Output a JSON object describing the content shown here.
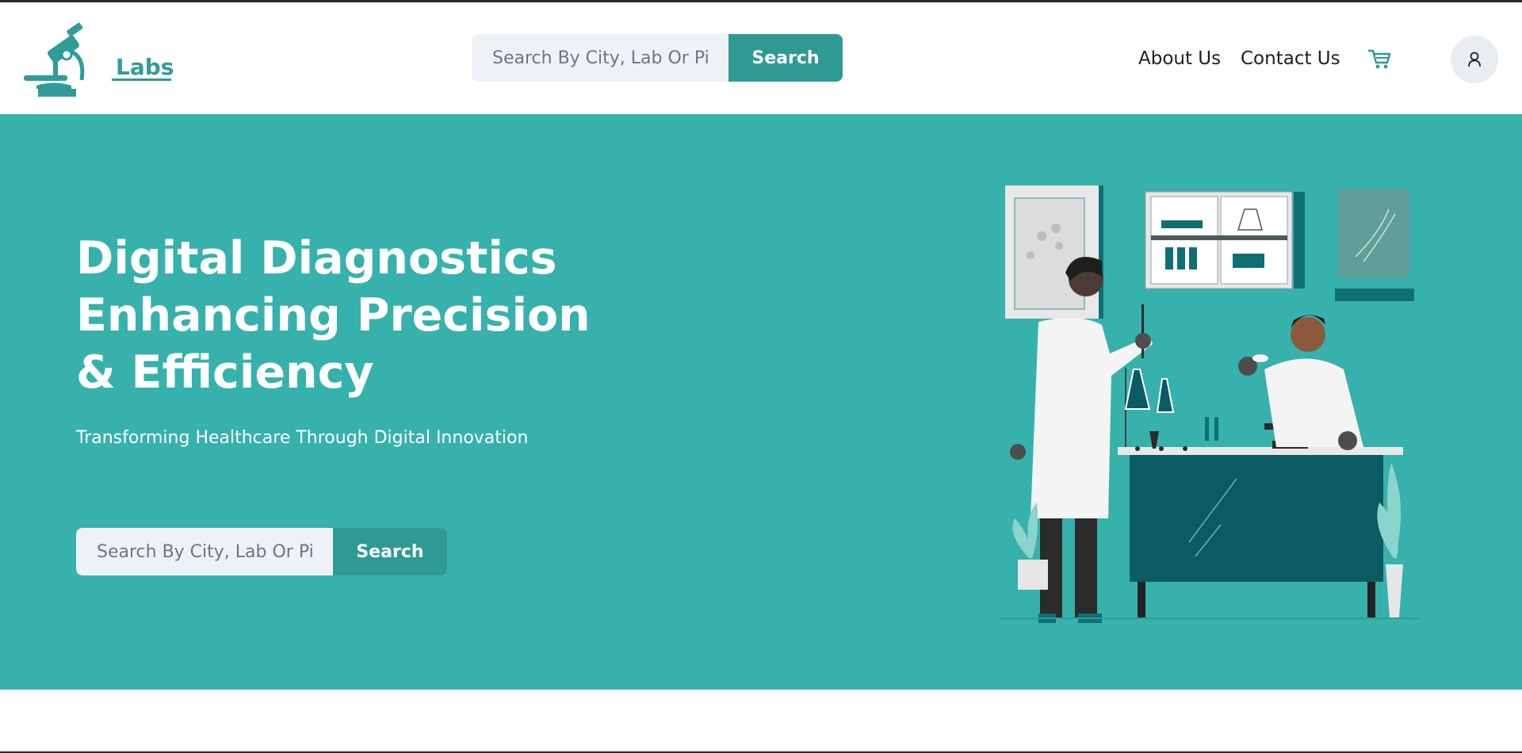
{
  "brand": {
    "name": "Labs",
    "accent": "#2f9c98",
    "hero_bg": "#37b1ac"
  },
  "header": {
    "search": {
      "placeholder": "Search By City, Lab Or Pin",
      "button_label": "Search"
    },
    "nav": [
      {
        "label": "About Us"
      },
      {
        "label": "Contact Us"
      }
    ],
    "cart_icon": "cart-icon",
    "profile_icon": "user-icon"
  },
  "hero": {
    "title_lines": [
      "Digital Diagnostics",
      "Enhancing Precision",
      "& Efficiency"
    ],
    "subtitle": "Transforming Healthcare Through Digital Innovation",
    "search": {
      "placeholder": "Search By City, Lab Or Pin",
      "button_label": "Search"
    },
    "illustration": "lab-scientists-illustration"
  }
}
